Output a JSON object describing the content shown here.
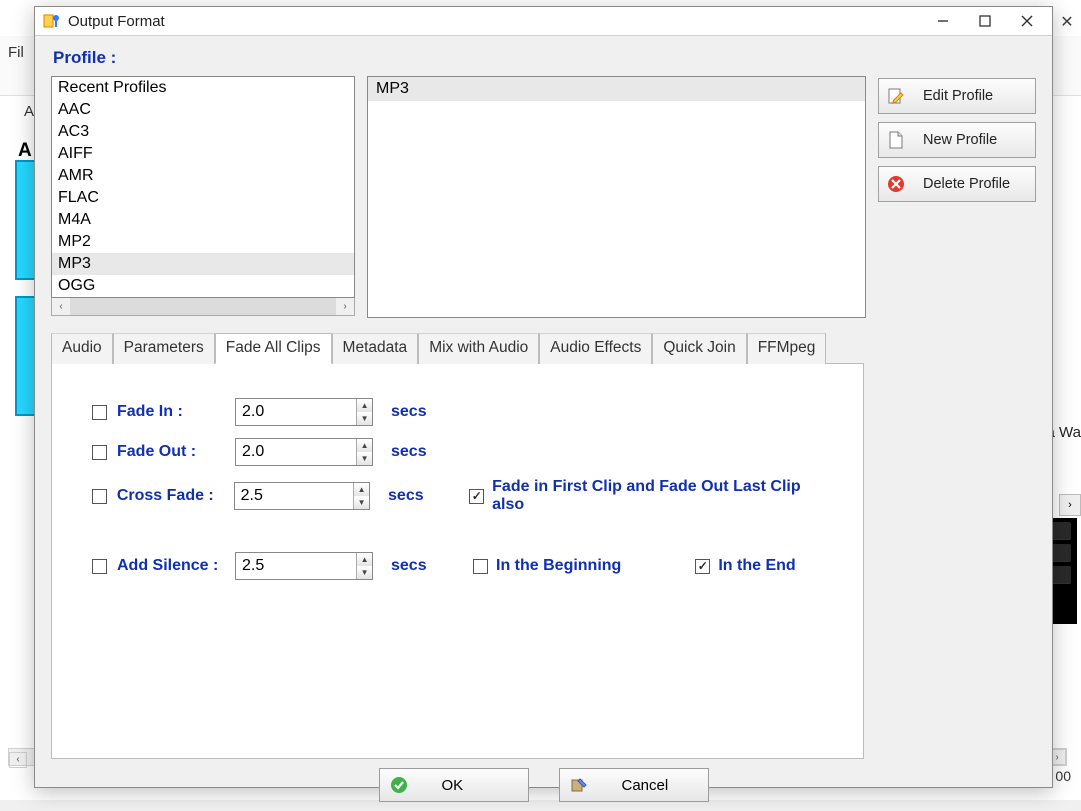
{
  "window": {
    "title": "Output Format"
  },
  "profile_header": "Profile :",
  "format_list": {
    "items": [
      "Recent Profiles",
      "AAC",
      "AC3",
      "AIFF",
      "AMR",
      "FLAC",
      "M4A",
      "MP2",
      "MP3",
      "OGG"
    ],
    "selected_index": 8
  },
  "detail_list": {
    "items": [
      "MP3"
    ],
    "selected_index": 0
  },
  "buttons": {
    "edit": "Edit Profile",
    "new": "New Profile",
    "delete": "Delete Profile"
  },
  "tabs": {
    "items": [
      "Audio",
      "Parameters",
      "Fade All Clips",
      "Metadata",
      "Mix with Audio",
      "Audio Effects",
      "Quick Join",
      "FFMpeg"
    ],
    "active_index": 2
  },
  "fade": {
    "fade_in": {
      "label": "Fade In :",
      "value": "2.0",
      "unit": "secs",
      "checked": false
    },
    "fade_out": {
      "label": "Fade Out :",
      "value": "2.0",
      "unit": "secs",
      "checked": false
    },
    "cross": {
      "label": "Cross Fade :",
      "value": "2.5",
      "unit": "secs",
      "checked": false,
      "firstlast_label": "Fade in First Clip and Fade Out Last Clip also",
      "firstlast_checked": true
    },
    "silence": {
      "label": "Add Silence :",
      "value": "2.5",
      "unit": "secs",
      "checked": false,
      "begin_label": "In the Beginning",
      "begin_checked": false,
      "end_label": "In the End",
      "end_checked": true
    }
  },
  "footer": {
    "ok": "OK",
    "cancel": "Cancel"
  },
  "bg": {
    "fil": "Fil",
    "ac": "Ac",
    "a": "A",
    "awal": "a Wa",
    "zeros": "00"
  }
}
